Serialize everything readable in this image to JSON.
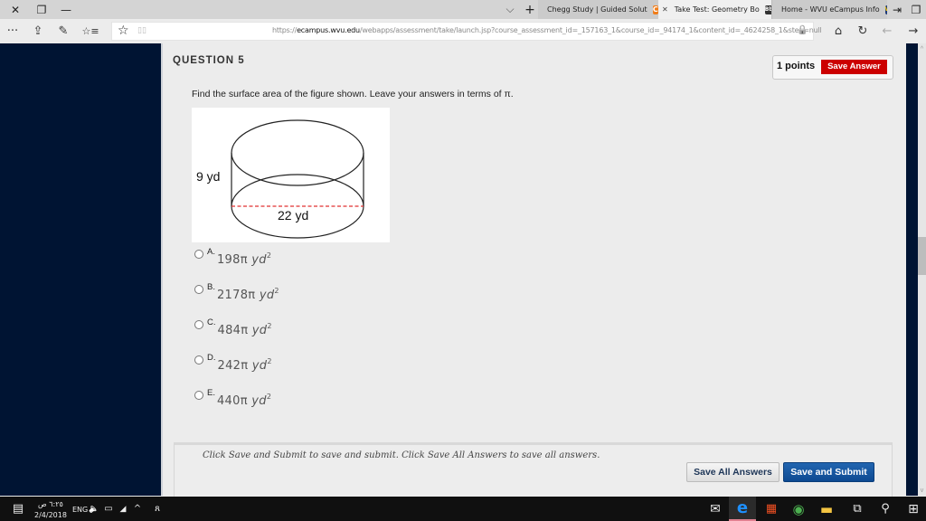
{
  "window": {
    "close_glyph": "✕",
    "restore_glyph": "❐",
    "minimize_glyph": "—",
    "tab_list_glyph": "⌵",
    "new_tab_glyph": "+",
    "set_aside_glyph": "⇥",
    "tab_preview_glyph": "❐"
  },
  "tabs": [
    {
      "label": "Chegg Study | Guided Solut",
      "favicon": "C",
      "favicon_color": "#f07d1a",
      "active": false
    },
    {
      "label": "Take Test: Geometry Bo",
      "favicon": "Bb",
      "favicon_color": "#333333",
      "active": true,
      "close_glyph": "✕"
    },
    {
      "label": "Home - WVU eCampus Info",
      "favicon": "WV",
      "favicon_color": "#f5c400",
      "active": false
    }
  ],
  "toolbar": {
    "more_glyph": "···",
    "share_glyph": "⇪",
    "notes_glyph": "✎",
    "favorites_glyph": "☆≡",
    "add_favorite_glyph": "☆",
    "reading_view_glyph": "▯▯",
    "lock_glyph": "🔒",
    "home_glyph": "⌂",
    "refresh_glyph": "↻",
    "back_glyph": "←",
    "forward_glyph": "→"
  },
  "address": {
    "prefix": "https://",
    "domain": "ecampus.wvu.edu",
    "path": "/webapps/assessment/take/launch.jsp?course_assessment_id=_157163_1&course_id=_94174_1&content_id=_4624258_1&step=null"
  },
  "question": {
    "title": "QUESTION 5",
    "points": "1 points",
    "save_answer": "Save Answer",
    "text": "Find the surface area of the figure shown. Leave your answers in terms of π.",
    "figure": {
      "height_label": "9 yd",
      "diameter_label": "22 yd"
    },
    "choices": [
      {
        "letter": "A.",
        "value": "198π",
        "unit": "yd",
        "exp": "2"
      },
      {
        "letter": "B.",
        "value": "2178π",
        "unit": "yd",
        "exp": "2"
      },
      {
        "letter": "C.",
        "value": "484π",
        "unit": "yd",
        "exp": "2"
      },
      {
        "letter": "D.",
        "value": "242π",
        "unit": "yd",
        "exp": "2"
      },
      {
        "letter": "E.",
        "value": "440π",
        "unit": "yd",
        "exp": "2"
      }
    ]
  },
  "submit": {
    "instructions": "Click Save and Submit to save and submit. Click Save All Answers to save all answers.",
    "save_all": "Save All Answers",
    "save_submit": "Save and Submit"
  },
  "taskbar": {
    "time": "٦:٢٥ ص",
    "date": "2/4/2018",
    "language": "ENG",
    "volume_glyph": "🔈",
    "battery_glyph": "▭",
    "wifi_glyph": "◢",
    "chevron_glyph": "^",
    "people_glyph": "ጸ",
    "mail_glyph": "✉",
    "edge_glyph": "e",
    "store_glyph": "▦",
    "chrome_glyph": "◉",
    "explorer_glyph": "▬",
    "taskview_glyph": "⧉",
    "search_glyph": "⚲",
    "start_glyph": "⊞",
    "notification_glyph": "▤"
  },
  "scroll": {
    "up_glyph": "^",
    "down_glyph": "v"
  },
  "colors": {
    "panel_navy": "#001433",
    "save_answer_red": "#cc0000",
    "submit_blue": "#0d4a92",
    "dashed_red": "#e03030"
  }
}
